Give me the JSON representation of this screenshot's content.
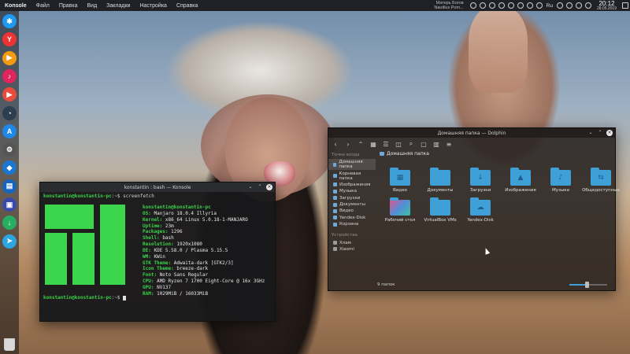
{
  "top_panel": {
    "app_name": "Konsole",
    "menu": [
      "Файл",
      "Правка",
      "Вид",
      "Закладки",
      "Настройка",
      "Справка"
    ],
    "now_playing_line1": "Матерь Богов",
    "now_playing_line2": "Nautilus Pom...",
    "layout": "Ru",
    "clock_time": "20:12",
    "clock_date": "28.05.2019"
  },
  "dock": {
    "icons": [
      {
        "name": "kde-menu-icon",
        "glyph": "✱",
        "color": "#1d99f3"
      },
      {
        "name": "yandex-browser-icon",
        "glyph": "Y",
        "color": "#e33"
      },
      {
        "name": "media-player-icon",
        "glyph": "▶",
        "color": "#f39c12"
      },
      {
        "name": "music-icon",
        "glyph": "♪",
        "color": "#e0245e"
      },
      {
        "name": "video-icon",
        "glyph": "▶",
        "color": "#e74c3c"
      },
      {
        "name": "system-monitor-icon",
        "glyph": "◔",
        "color": "#2c3e50"
      },
      {
        "name": "app-store-icon",
        "glyph": "A",
        "color": "#1e88e5"
      },
      {
        "name": "settings-icon",
        "glyph": "⚙",
        "color": "#555"
      },
      {
        "name": "virtualbox-icon",
        "glyph": "◆",
        "color": "#1976d2"
      },
      {
        "name": "files-icon",
        "glyph": "▤",
        "color": "#1565c0"
      },
      {
        "name": "screen-icon",
        "glyph": "▣",
        "color": "#3949ab"
      },
      {
        "name": "download-icon",
        "glyph": "↓",
        "color": "#27ae60"
      },
      {
        "name": "telegram-icon",
        "glyph": "➤",
        "color": "#2ca5e0"
      }
    ]
  },
  "konsole": {
    "title": "konstantin : bash — Konsole",
    "prompt_host": "konstantin@konstantin-pc",
    "prompt_suffix": ":~$",
    "command": "screenfetch",
    "user_host": "konstantin@konstantin-pc",
    "info": [
      {
        "key": "OS:",
        "value": "Manjaro 18.0.4 Illyria"
      },
      {
        "key": "Kernel:",
        "value": "x86_64 Linux 5.0.18-1-MANJARO"
      },
      {
        "key": "Uptime:",
        "value": "23m"
      },
      {
        "key": "Packages:",
        "value": "1296"
      },
      {
        "key": "Shell:",
        "value": "bash"
      },
      {
        "key": "Resolution:",
        "value": "1920x1080"
      },
      {
        "key": "DE:",
        "value": "KDE 5.58.0 / Plasma 5.15.5"
      },
      {
        "key": "WM:",
        "value": "KWin"
      },
      {
        "key": "GTK Theme:",
        "value": "Adwaita-dark [GTK2/3]"
      },
      {
        "key": "Icon Theme:",
        "value": "breeze-dark"
      },
      {
        "key": "Font:",
        "value": "Noto Sans Regular"
      },
      {
        "key": "CPU:",
        "value": "AMD Ryzen 7 1700 Eight-Core @ 16x 3GHz"
      },
      {
        "key": "GPU:",
        "value": "NV137"
      },
      {
        "key": "RAM:",
        "value": "1029MiB / 16033MiB"
      }
    ]
  },
  "dolphin": {
    "title": "Домашняя папка — Dolphin",
    "breadcrumb": "Домашняя папка",
    "sidebar": {
      "section1": "Точки входа",
      "places": [
        {
          "label": "Домашняя папка",
          "active": true
        },
        {
          "label": "Корневая папка",
          "active": false
        },
        {
          "label": "Изображения",
          "active": false
        },
        {
          "label": "Музыка",
          "active": false
        },
        {
          "label": "Загрузки",
          "active": false
        },
        {
          "label": "Документы",
          "active": false
        },
        {
          "label": "Видео",
          "active": false
        },
        {
          "label": "Yandex-Disk",
          "active": false
        },
        {
          "label": "Корзина",
          "active": false
        }
      ],
      "section2": "Устройства",
      "devices": [
        {
          "label": "Хлам"
        },
        {
          "label": "Xiaomi"
        }
      ]
    },
    "folders": [
      {
        "label": "Видео",
        "glyph": "▦",
        "kind": "folder"
      },
      {
        "label": "Документы",
        "glyph": "",
        "kind": "folder"
      },
      {
        "label": "Загрузки",
        "glyph": "↓",
        "kind": "folder"
      },
      {
        "label": "Изображения",
        "glyph": "▲",
        "kind": "folder"
      },
      {
        "label": "Музыка",
        "glyph": "♪",
        "kind": "folder"
      },
      {
        "label": "Общедоступные",
        "glyph": "⇆",
        "kind": "folder"
      },
      {
        "label": "Рабочий стол",
        "glyph": "",
        "kind": "kde"
      },
      {
        "label": "VirtualBox VMs",
        "glyph": "",
        "kind": "folder"
      },
      {
        "label": "Yandex-Disk",
        "glyph": "☁",
        "kind": "folder"
      }
    ],
    "status": "9 папок",
    "zoom_fraction": 0.45
  }
}
